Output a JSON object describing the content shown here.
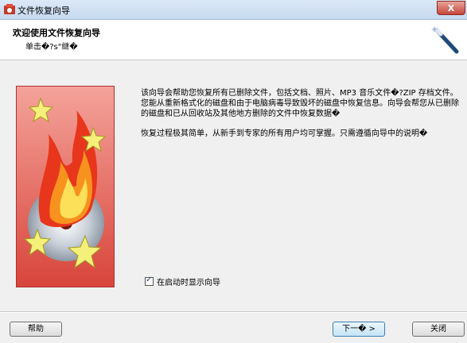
{
  "window": {
    "title": "文件恢复向导",
    "close_glyph": "X"
  },
  "header": {
    "title": "欢迎使用文件恢复向导",
    "subtitle": "单击�?s\"继�"
  },
  "content": {
    "paragraph1": "该向导会帮助您恢复所有已删除文件，包括文档、照片、MP3 音乐文件�?ZIP 存档文件。您能从重新格式化的磁盘和由于电脑病毒导致毁坏的磁盘中恢复信息。向导会帮您从已删除的磁盘和已从回收站及其他地方删除的文件中恢复数据�",
    "paragraph2": "恢复过程极其简单，从新手到专家的所有用户均可掌握。只需遵循向导中的说明�"
  },
  "checkbox": {
    "label": "在启动时显示向导",
    "checked": true
  },
  "buttons": {
    "help": "帮助",
    "next": "下一� >",
    "close": "关闭"
  },
  "colors": {
    "banner_bg": "#e8827a",
    "accent": "#3c7fb1"
  }
}
